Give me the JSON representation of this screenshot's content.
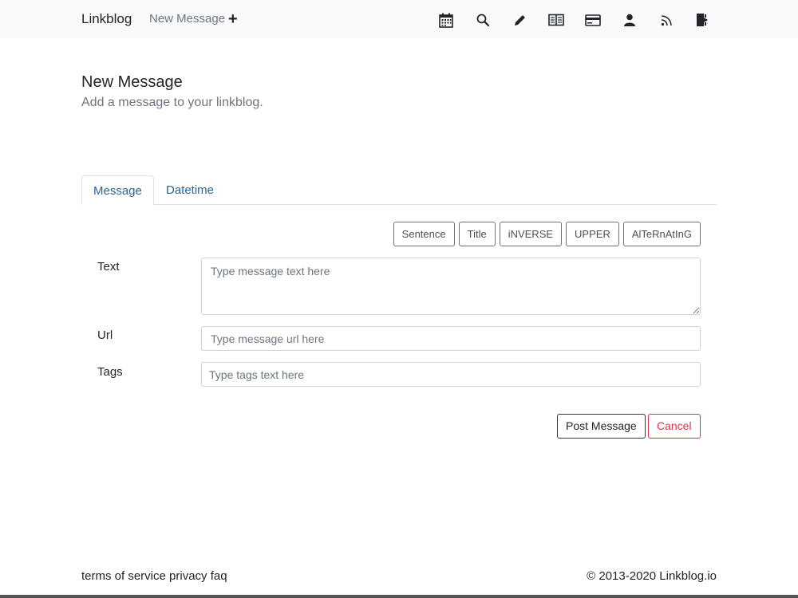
{
  "nav": {
    "brand": "Linkblog",
    "new_message": "New Message",
    "plus": "+",
    "icons": [
      "calendar-icon",
      "search-icon",
      "pencil-icon",
      "book-icon",
      "credit-card-icon",
      "user-icon",
      "rss-icon",
      "logout-icon"
    ]
  },
  "header": {
    "title": "New Message",
    "subtitle": "Add a message to your linkblog."
  },
  "tabs": [
    {
      "label": "Message",
      "active": true
    },
    {
      "label": "Datetime",
      "active": false
    }
  ],
  "case_buttons": [
    "Sentence",
    "Title",
    "iNVERSE",
    "UPPER",
    "AlTeRnAtInG"
  ],
  "form": {
    "text_label": "Text",
    "text_placeholder": "Type message text here",
    "url_label": "Url",
    "url_placeholder": "Type message url here",
    "tags_label": "Tags",
    "tags_placeholder": "Type tags text here"
  },
  "actions": {
    "post": "Post Message",
    "cancel": "Cancel"
  },
  "footer": {
    "terms": "terms of service",
    "privacy": "privacy",
    "faq": "faq",
    "copyright": "© 2013-2020 Linkblog.io"
  },
  "colors": {
    "navbar_bg": "#f8f9fa",
    "tab_link": "#2a6496",
    "cancel": "#dc3545"
  }
}
